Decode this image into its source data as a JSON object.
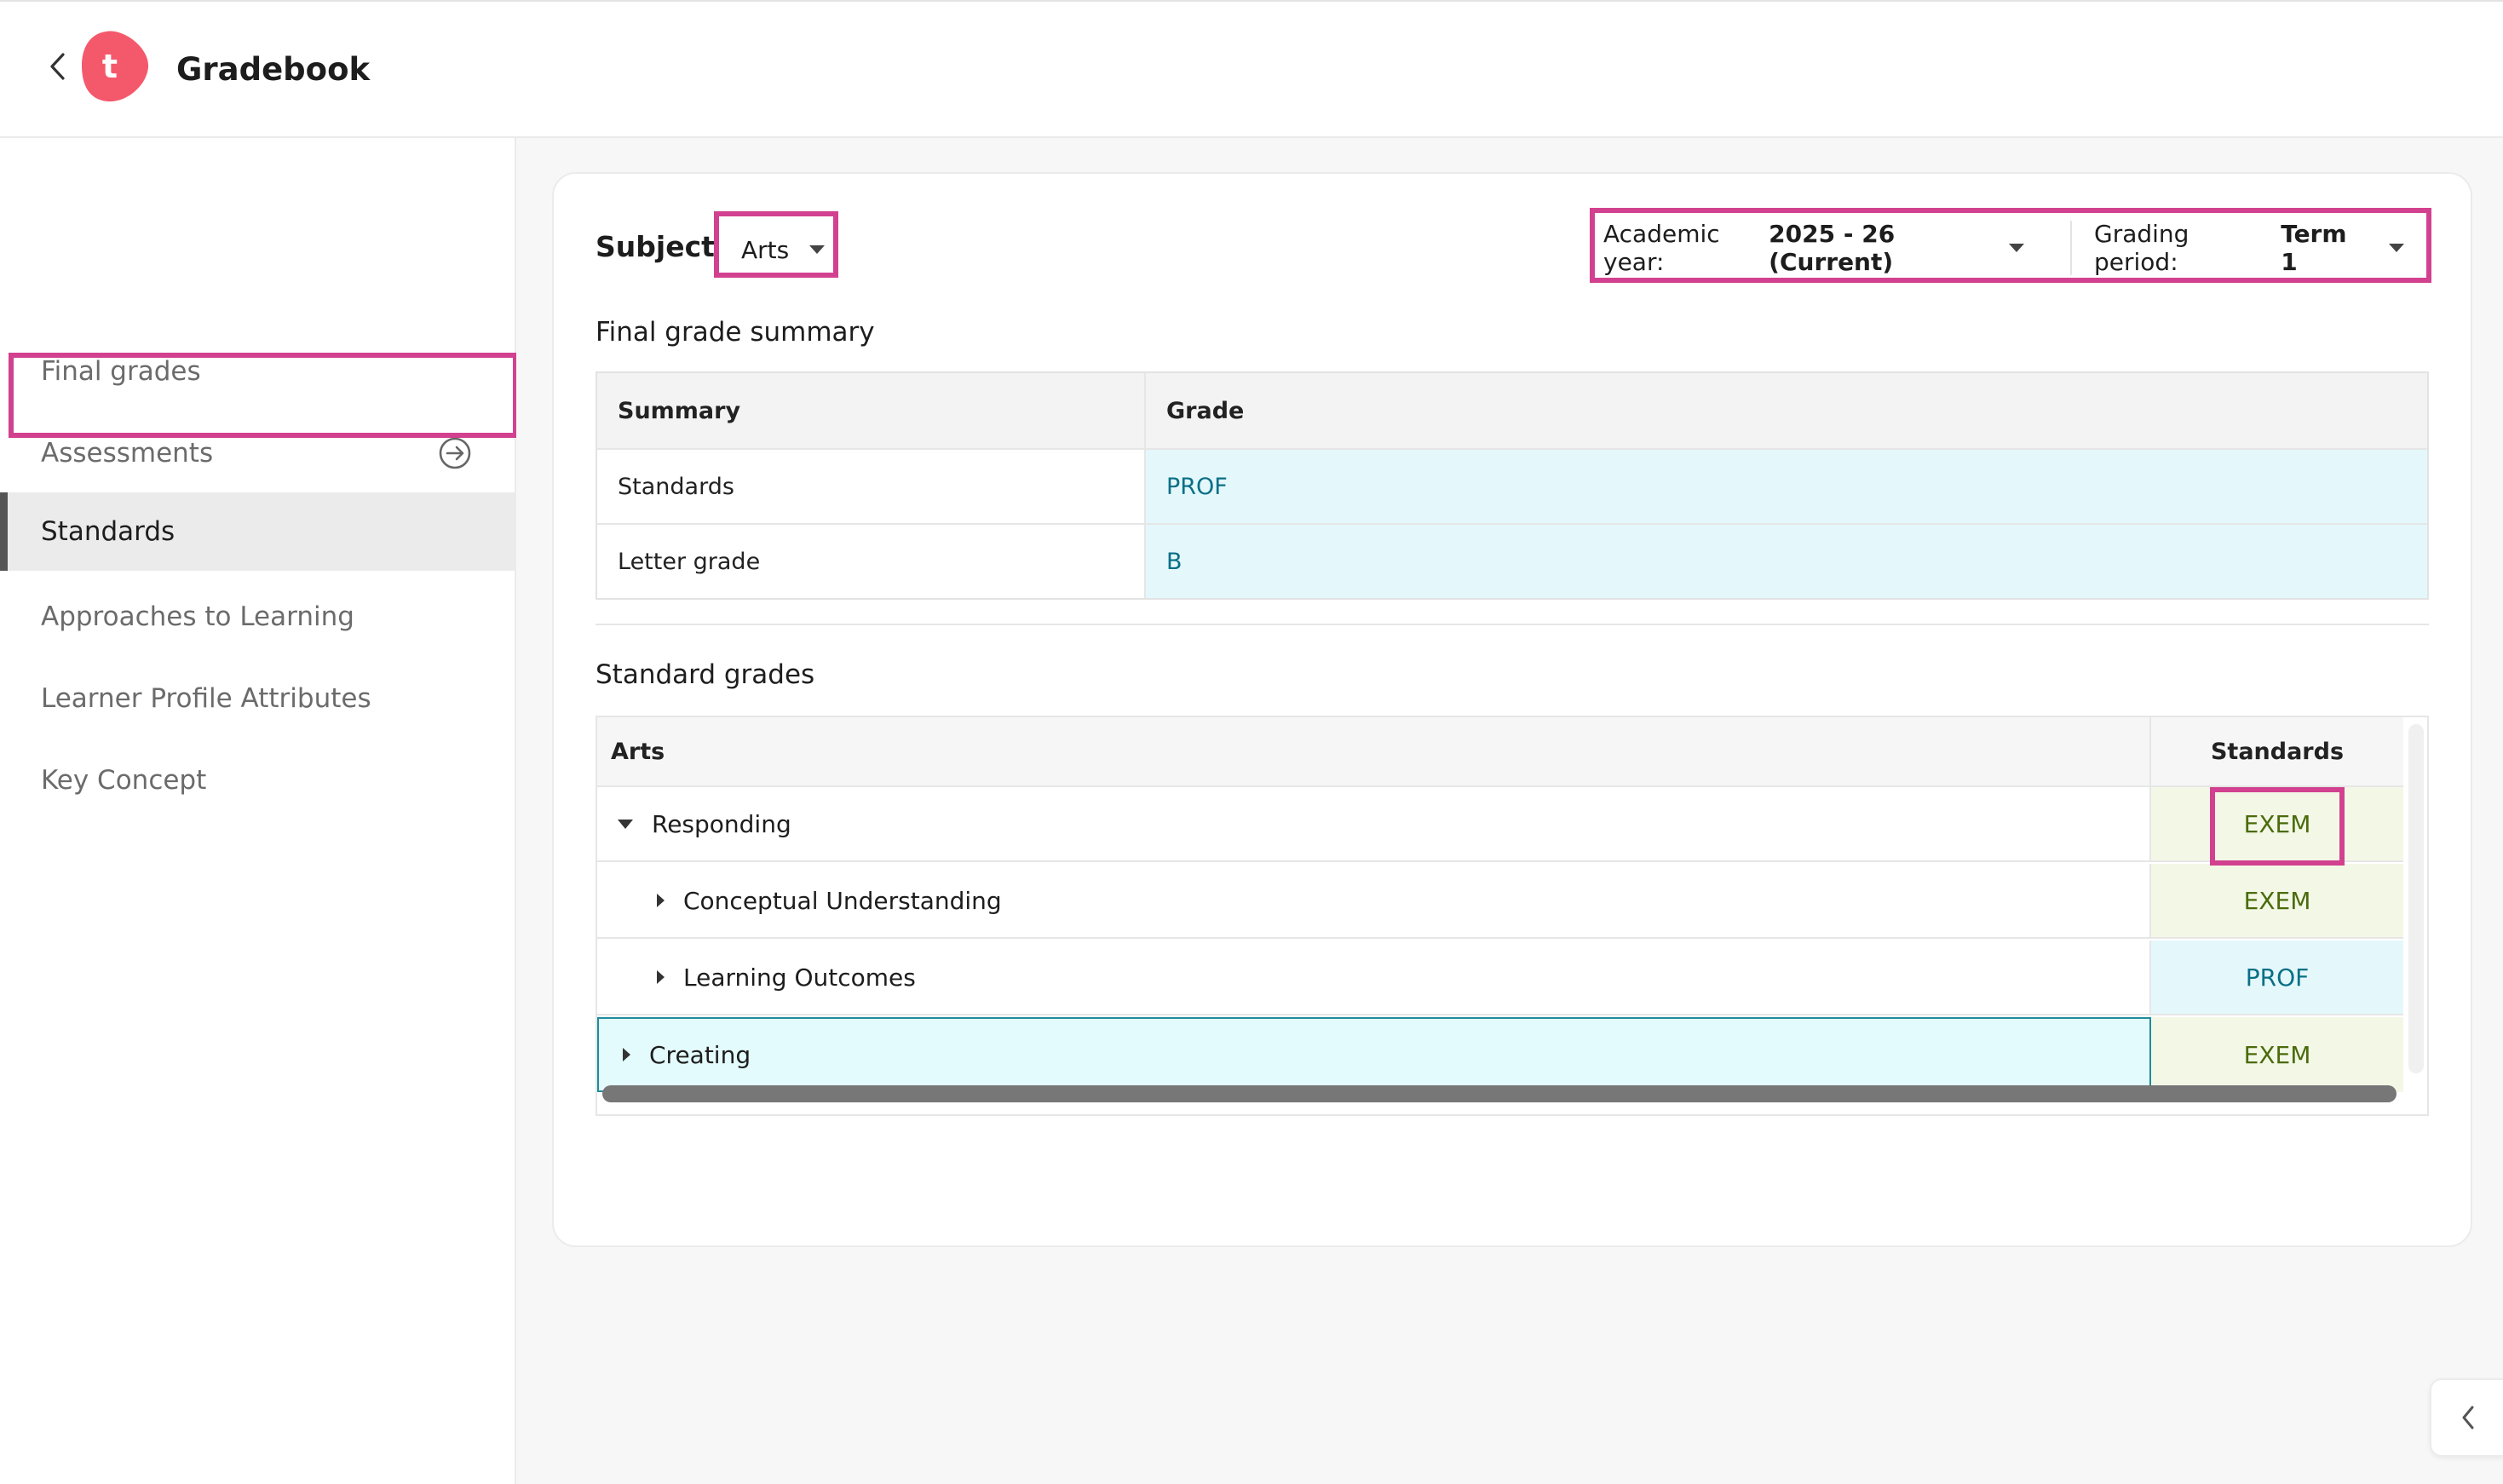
{
  "app": {
    "title": "Gradebook",
    "logo_letter": "t",
    "brand_color": "#f4596b",
    "highlight_color": "#d2418f"
  },
  "sidebar": {
    "items": [
      {
        "label": "Final grades",
        "active": false
      },
      {
        "label": "Assessments",
        "active": false,
        "icon": "arrow-circle-right-icon"
      },
      {
        "label": "Standards",
        "active": true
      },
      {
        "label": "Approaches to Learning",
        "active": false
      },
      {
        "label": "Learner Profile Attributes",
        "active": false
      },
      {
        "label": "Key Concept",
        "active": false
      }
    ]
  },
  "filters": {
    "subject_label": "Subject",
    "subject_value": "Arts",
    "academic_year_label": "Academic year:",
    "academic_year_value": "2025 - 26 (Current)",
    "grading_period_label": "Grading period:",
    "grading_period_value": "Term 1"
  },
  "final_grade_summary": {
    "title": "Final grade summary",
    "columns": [
      "Summary",
      "Grade"
    ],
    "rows": [
      {
        "summary": "Standards",
        "grade": "PROF"
      },
      {
        "summary": "Letter grade",
        "grade": "B"
      }
    ]
  },
  "standard_grades": {
    "title": "Standard grades",
    "columns": [
      "Arts",
      "Standards"
    ],
    "rows": [
      {
        "label": "Responding",
        "grade": "EXEM",
        "level": 0,
        "expanded": true
      },
      {
        "label": "Conceptual Understanding",
        "grade": "EXEM",
        "level": 1,
        "expanded": false
      },
      {
        "label": "Learning Outcomes",
        "grade": "PROF",
        "level": 1,
        "expanded": false
      },
      {
        "label": "Creating",
        "grade": "EXEM",
        "level": 0,
        "expanded": false,
        "selected": true
      }
    ]
  },
  "colors": {
    "exem_bg": "#f3f8e6",
    "exem_text": "#4b6b0c",
    "prof_bg": "#e4f8fc",
    "prof_text": "#0a6f86"
  }
}
